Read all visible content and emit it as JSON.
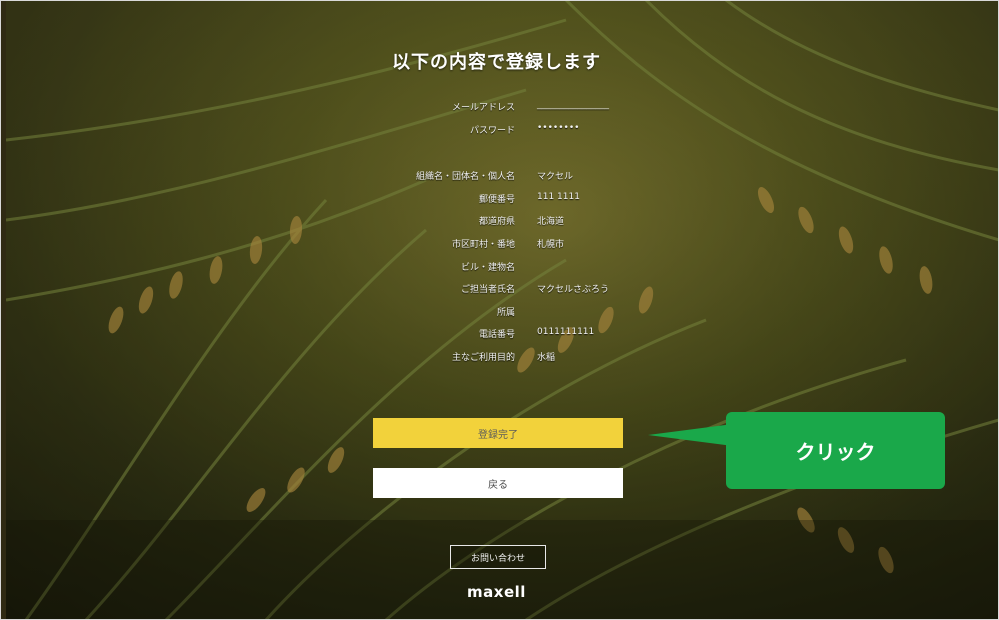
{
  "page": {
    "title": "以下の内容で登録します"
  },
  "form": {
    "rows": [
      {
        "label": "メールアドレス",
        "value": "________________"
      },
      {
        "label": "パスワード",
        "value": "••••••••"
      },
      {
        "label": "組織名・団体名・個人名",
        "value": "マクセル"
      },
      {
        "label": "郵便番号",
        "value": "111 1111"
      },
      {
        "label": "都道府県",
        "value": "北海道"
      },
      {
        "label": "市区町村・番地",
        "value": "札幌市"
      },
      {
        "label": "ビル・建物名",
        "value": ""
      },
      {
        "label": "ご担当者氏名",
        "value": "マクセルさぶろう"
      },
      {
        "label": "所属",
        "value": ""
      },
      {
        "label": "電話番号",
        "value": "0111111111"
      },
      {
        "label": "主なご利用目的",
        "value": "水稲"
      }
    ]
  },
  "buttons": {
    "complete_label": "登録完了",
    "back_label": "戻る",
    "contact_label": "お問い合わせ"
  },
  "footer": {
    "logo_text": "maxell"
  },
  "annotation": {
    "callout_text": "クリック",
    "callout_color": "#1aa84a"
  },
  "colors": {
    "primary_button": "#f2d23b",
    "secondary_button": "#ffffff"
  }
}
